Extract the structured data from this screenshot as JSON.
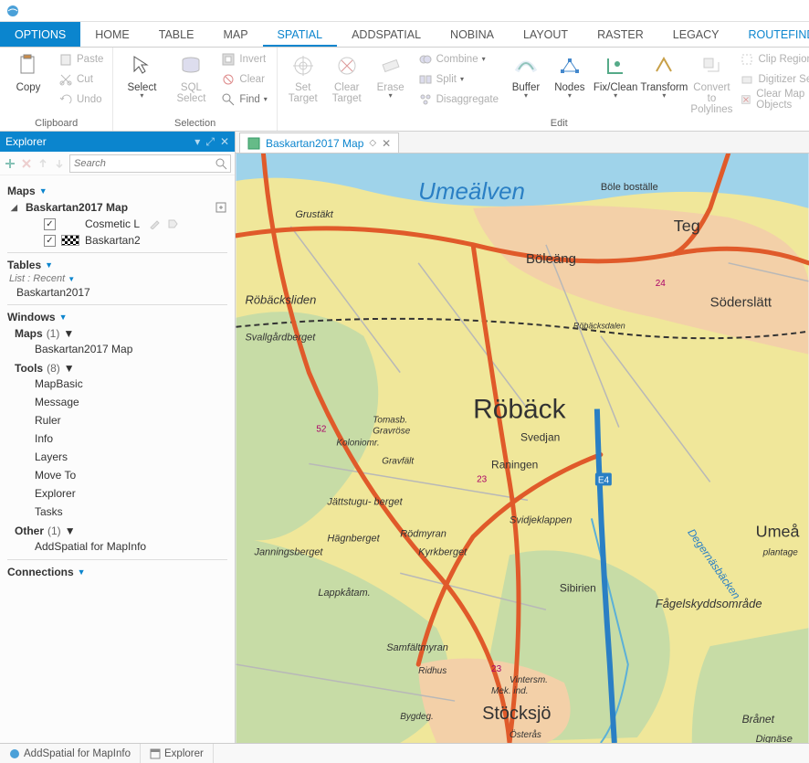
{
  "app": {
    "title": ""
  },
  "tabs": {
    "options": "OPTIONS",
    "home": "HOME",
    "table": "TABLE",
    "map": "MAP",
    "spatial": "SPATIAL",
    "addspatial": "ADDSPATIAL",
    "nobina": "NOBINA",
    "layout": "LAYOUT",
    "raster": "RASTER",
    "legacy": "LEGACY",
    "routefinder": "ROUTEFINDER"
  },
  "ribbon": {
    "clipboard": {
      "label": "Clipboard",
      "copy": "Copy",
      "paste": "Paste",
      "cut": "Cut",
      "undo": "Undo"
    },
    "selection": {
      "label": "Selection",
      "select": "Select",
      "sql": "SQL Select",
      "invert": "Invert",
      "clear": "Clear",
      "find": "Find"
    },
    "edit": {
      "label": "Edit",
      "set_target": "Set Target",
      "clear_target": "Clear Target",
      "erase": "Erase",
      "combine": "Combine",
      "split": "Split",
      "disaggregate": "Disaggregate",
      "buffer": "Buffer",
      "nodes": "Nodes",
      "fixclean": "Fix/Clean",
      "transform": "Transform",
      "convert": "Convert to Polylines",
      "clip_region": "Clip Region",
      "digitizer": "Digitizer Setup",
      "clear_map": "Clear Map Objects"
    }
  },
  "explorer": {
    "title": "Explorer",
    "search_placeholder": "Search",
    "maps_section": "Maps",
    "map_root": "Baskartan2017 Map",
    "layer_cosmetic": "Cosmetic L",
    "layer_base": "Baskartan2",
    "tables_section": "Tables",
    "tables_mode": "List : Recent",
    "table_item": "Baskartan2017",
    "windows_section": "Windows",
    "maps_sub": "Maps",
    "maps_count": "(1)",
    "map_window": "Baskartan2017 Map",
    "tools_sub": "Tools",
    "tools_count": "(8)",
    "tool_mapbasic": "MapBasic",
    "tool_message": "Message",
    "tool_ruler": "Ruler",
    "tool_info": "Info",
    "tool_layers": "Layers",
    "tool_moveto": "Move To",
    "tool_explorer": "Explorer",
    "tool_tasks": "Tasks",
    "other_sub": "Other",
    "other_count": "(1)",
    "other_item": "AddSpatial for MapInfo",
    "connections_section": "Connections"
  },
  "maptab": {
    "title": "Baskartan2017 Map"
  },
  "map_labels": {
    "river": "Umeälven",
    "bole": "Böle boställe",
    "grustakt": "Grustäkt",
    "teg": "Teg",
    "boleang": "Böleäng",
    "soderslatt": "Söderslätt",
    "robacksdalen": "Röbäcksdalen",
    "robacksliden": "Röbäcksliden",
    "svallgard": "Svallgårdberget",
    "roback": "Röbäck",
    "tomasb": "Tomasb.",
    "gravrose": "Gravröse",
    "koloniomr": "Koloniomr.",
    "gravfalt": "Gravfält",
    "svedjan": "Svedjan",
    "raningen": "Raningen",
    "jattstugu": "Jättstugu-\nberget",
    "hagnberget": "Hägnberget",
    "janningsberget": "Janningsberget",
    "rodmyran": "Rödmyran",
    "kyrkberget": "Kyrkberget",
    "svidjeklappen": "Svidjeklappen",
    "umea": "Umeå",
    "plantage": "plantage",
    "sibirien": "Sibirien",
    "lappkatam": "Lappkåtam.",
    "fagelskydd": "Fågelskyddsområde",
    "degernas": "Degernäsbäcken",
    "samfalt": "Samfältmyran",
    "ridhus": "Ridhus",
    "vintersm": "Vintersm.",
    "mekind": "Mek. ind.",
    "stocksjo": "Stöcksjö",
    "bygdeg": "Bygdeg.",
    "osteras": "Österås",
    "branet": "Brånet",
    "dignasen": "Dignäse",
    "n52": "52",
    "n24": "24",
    "n23": "23",
    "n23b": "23",
    "e4": "E4"
  },
  "bottom": {
    "addspatial": "AddSpatial for MapInfo",
    "explorer": "Explorer"
  },
  "colors": {
    "accent": "#0b85ce",
    "water": "#9fd3ea",
    "forest": "#c7dca6",
    "field": "#f0e79a",
    "urban": "#f3d0a8",
    "road_major": "#e05a2a",
    "road_minor": "#b8b8b8"
  }
}
